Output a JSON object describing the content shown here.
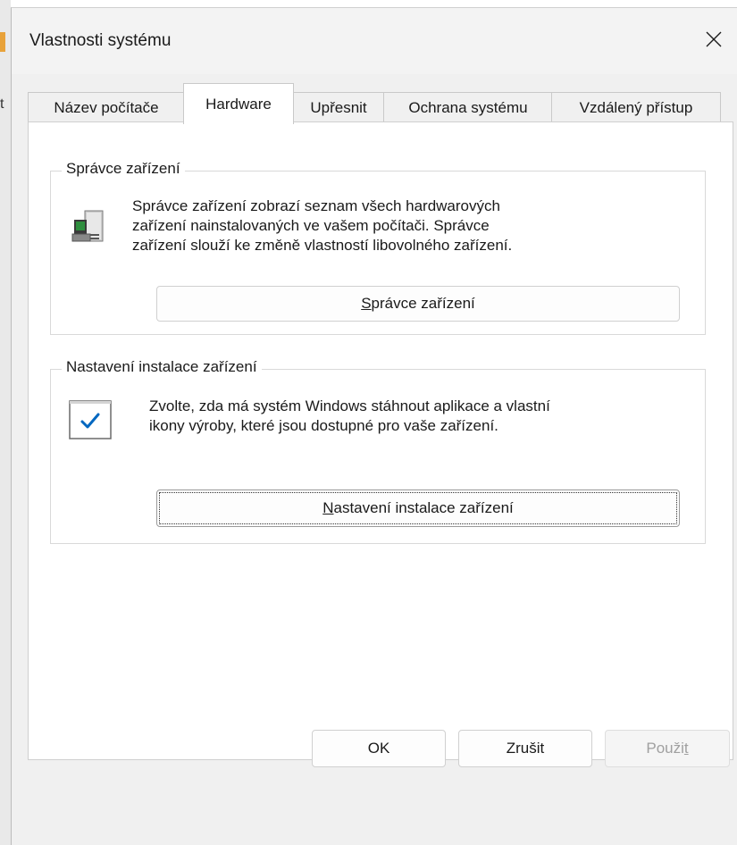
{
  "window": {
    "title": "Vlastnosti systému",
    "close_icon": "close-icon"
  },
  "background": {
    "fragment": "t"
  },
  "tabs": [
    {
      "label": "Název počítače",
      "active": false
    },
    {
      "label": "Hardware",
      "active": true
    },
    {
      "label": "Upřesnit",
      "active": false
    },
    {
      "label": "Ochrana systému",
      "active": false
    },
    {
      "label": "Vzdálený přístup",
      "active": false
    }
  ],
  "device_manager": {
    "legend": "Správce zařízení",
    "icon": "device-manager-icon",
    "description_lines": [
      "Správce zařízení zobrazí seznam všech hardwarových",
      "zařízení nainstalovaných ve vašem počítači. Správce",
      "zařízení slouží ke změně vlastností libovolného zařízení."
    ],
    "button_access_key": "S",
    "button_rest": "právce zařízení"
  },
  "install_settings": {
    "legend": "Nastavení instalace zařízení",
    "icon": "checkmark-icon",
    "description_lines": [
      "Zvolte, zda má systém Windows stáhnout aplikace a vlastní",
      "ikony výroby, které jsou dostupné pro vaše zařízení."
    ],
    "button_access_key": "N",
    "button_rest": "astavení instalace zařízení"
  },
  "footer": {
    "ok_label": "OK",
    "cancel_label": "Zrušit",
    "apply_prefix": "Použi",
    "apply_access_key": "t"
  },
  "colors": {
    "accent": "#0067c0",
    "window_bg": "#f0f0f0",
    "panel_bg": "#ffffff"
  }
}
